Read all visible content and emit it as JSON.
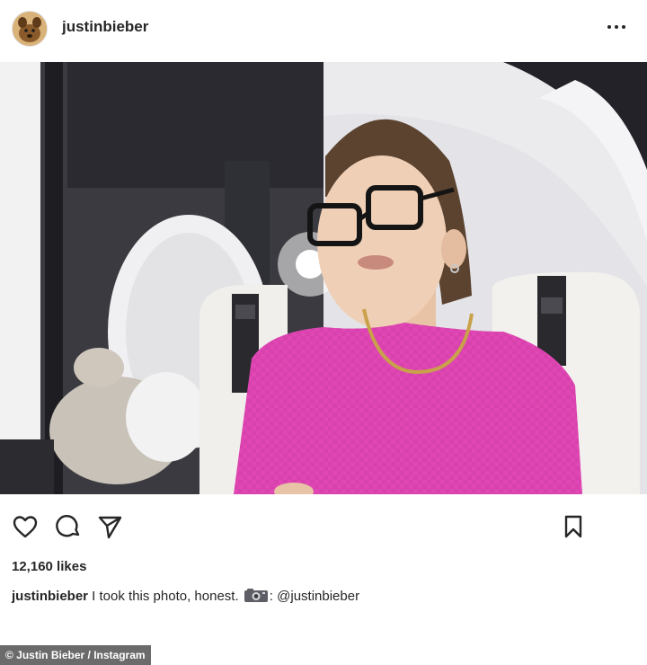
{
  "header": {
    "username": "justinbieber",
    "more_icon": "ellipsis-icon"
  },
  "post": {
    "image_alt": "Woman in pink knit top and black glasses seated on a private jet"
  },
  "actions": {
    "like_icon": "heart-icon",
    "comment_icon": "comment-icon",
    "share_icon": "paper-plane-icon",
    "save_icon": "bookmark-icon"
  },
  "likes": "12,160 likes",
  "caption": {
    "username": "justinbieber",
    "text": " I took this photo, honest. ",
    "camera_icon": "camera-icon",
    "mention": ": @justinbieber"
  },
  "credit": "© Justin Bieber / Instagram",
  "colors": {
    "sweater": "#e046b4",
    "text": "#262626",
    "credit_bg": "#6b6b6b"
  }
}
